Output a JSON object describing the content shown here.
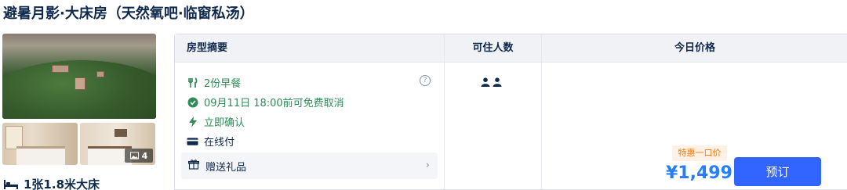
{
  "room": {
    "title": "避暑月影·大床房（天然氧吧·临窗私汤）",
    "photo_count": "4",
    "bed": "1张1.8米大床"
  },
  "table": {
    "headers": {
      "summary": "房型摘要",
      "occupancy": "可住人数",
      "price": "今日价格"
    },
    "features": [
      {
        "icon": "cutlery-icon",
        "text": "2份早餐"
      },
      {
        "icon": "check-circle-icon",
        "text": "09月11日 18:00前可免费取消"
      },
      {
        "icon": "lightning-icon",
        "text": "立即确认"
      },
      {
        "icon": "card-icon",
        "text": "在线付"
      }
    ],
    "gift": {
      "icon": "gift-icon",
      "text": "赠送礼品"
    },
    "occupancy": {
      "icon": "person-icon"
    },
    "offer": {
      "promo": "特惠一口价",
      "price": "¥1,499",
      "book_label": "预订"
    }
  },
  "colors": {
    "accent": "#3264ff",
    "price": "#287dfa",
    "promo": "#ff7700",
    "feature": "#2e8b57"
  }
}
